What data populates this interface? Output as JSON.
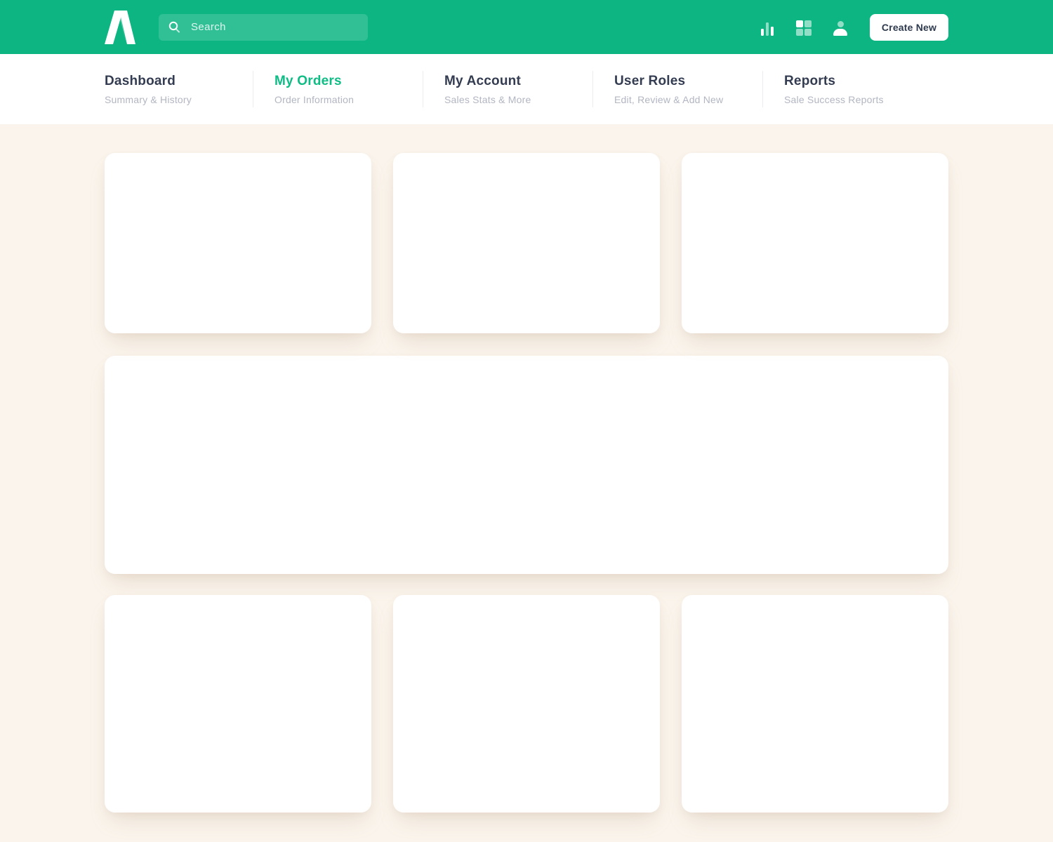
{
  "header": {
    "search": {
      "placeholder": "Search"
    },
    "create_button_label": "Create New",
    "icons": {
      "logo": "brand-logo",
      "search": "magnifier",
      "stats": "bar-chart",
      "apps": "grid-squares",
      "profile": "person"
    }
  },
  "nav": {
    "tabs": [
      {
        "label": "Dashboard",
        "sublabel": "Summary & History",
        "active": false
      },
      {
        "label": "My Orders",
        "sublabel": "Order Information",
        "active": true
      },
      {
        "label": "My Account",
        "sublabel": "Sales Stats & More",
        "active": false
      },
      {
        "label": "User Roles",
        "sublabel": "Edit, Review & Add New",
        "active": false
      },
      {
        "label": "Reports",
        "sublabel": "Sale Success Reports",
        "active": false
      }
    ]
  },
  "content": {
    "cards": [
      "top-1",
      "top-2",
      "top-3",
      "wide",
      "bottom-1",
      "bottom-2",
      "bottom-3"
    ]
  },
  "colors": {
    "accent_green": "#0DB583",
    "active_tab_green": "#10BC85",
    "background_cream": "#FAF4EC",
    "card_white": "#FFFFFF",
    "text_dark": "#333C50",
    "text_muted": "#B2B6C3"
  }
}
